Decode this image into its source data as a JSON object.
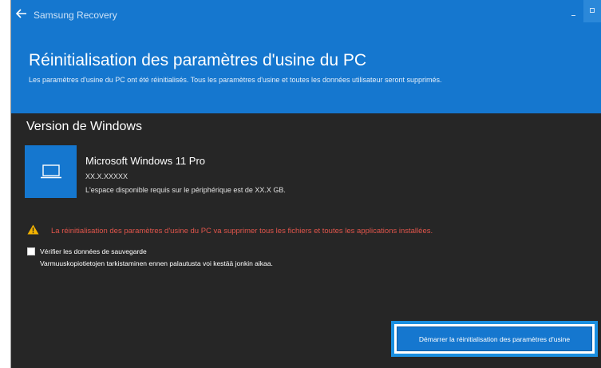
{
  "colors": {
    "accent": "#1577cf",
    "background": "#262626",
    "warning": "#e0554b",
    "highlight_border": "#1a8fe0"
  },
  "titlebar": {
    "back_icon": "arrow-left-icon",
    "app_title": "Samsung Recovery",
    "controls": [
      "minimize-icon",
      "maximize-icon"
    ]
  },
  "header": {
    "title": "Réinitialisation des paramètres d'usine du PC",
    "subtitle": "Les paramètres d'usine du PC ont été réinitialisés. Tous les paramètres d'usine et toutes les données utilisateur seront supprimés."
  },
  "windows_version": {
    "section_title": "Version de Windows",
    "icon": "laptop-icon",
    "name": "Microsoft Windows 11 Pro",
    "version": "XX.X.XXXXX",
    "space_required": "L'espace disponible requis sur le périphérique est de XX.X GB."
  },
  "warning": {
    "icon": "warning-triangle-icon",
    "text": "La réinitialisation des paramètres d'usine du PC va supprimer tous les fichiers et toutes les applications installées."
  },
  "backup": {
    "checked": false,
    "label": "Vérifier les données de sauvegarde",
    "note": "Varmuuskopiotietojen tarkistaminen ennen palautusta voi kestää jonkin aikaa."
  },
  "actions": {
    "start_label": "Démarrer la réinitialisation des paramètres d'usine"
  }
}
